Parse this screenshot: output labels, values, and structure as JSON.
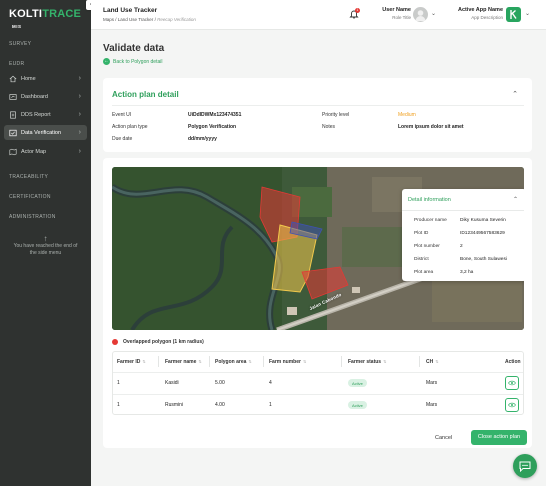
{
  "brand": {
    "logo_main": "KOLTI",
    "logo_accent": "TRACE",
    "logo_sub": "MIS"
  },
  "sidebar": {
    "sections": {
      "survey": "SURVEY",
      "eudr": "EUDR",
      "traceability": "TRACEABILITY",
      "certification": "CERTIFICATION",
      "administration": "ADMINISTRATION"
    },
    "items": [
      {
        "label": "Home",
        "icon": "home-icon",
        "active": false
      },
      {
        "label": "Dashboard",
        "icon": "dashboard-icon",
        "active": false
      },
      {
        "label": "DDS Report",
        "icon": "report-icon",
        "active": false
      },
      {
        "label": "Data Verification",
        "icon": "verification-icon",
        "active": true
      },
      {
        "label": "Actor Map",
        "icon": "map-icon",
        "active": false
      }
    ],
    "end_text_line1": "You have reached the end of",
    "end_text_line2": "the side menu"
  },
  "header": {
    "title": "Land Use Tracker",
    "breadcrumb": {
      "part1": "Maps",
      "part2": "Land Use Tracker",
      "current": "Reecap Verification"
    },
    "notification_count": "1",
    "user": {
      "name": "User Name",
      "role": "Role Title"
    },
    "app": {
      "name": "Active App Name",
      "description": "App Description"
    }
  },
  "page": {
    "title": "Validate data",
    "back_link": "Back to Polygon detail"
  },
  "action_plan": {
    "title": "Action plan detail",
    "fields": {
      "event_uid_label": "Event UI",
      "event_uid_value": "UiDdIDWMx123474351",
      "plan_type_label": "Action plan type",
      "plan_type_value": "Polygon Verification",
      "due_date_label": "Due date",
      "due_date_value": "dd/mm/yyyy",
      "priority_label": "Priority level",
      "priority_value": "Medium",
      "notes_label": "Notes",
      "notes_value": "Lorem ipsum dolor sit amet"
    }
  },
  "detail_info": {
    "title": "Detail information",
    "producer_label": "Producer name",
    "producer_value": "Diky Kusuma Severin",
    "plot_id_label": "Plot ID",
    "plot_id_value": "ID123449567583629",
    "plot_number_label": "Plot number",
    "plot_number_value": "2",
    "district_label": "District",
    "district_value": "Bone, South Sulawesi",
    "plot_area_label": "Plot area",
    "plot_area_value": "3,2 ha"
  },
  "map": {
    "road_label": "Jalan Cabondo"
  },
  "legend": {
    "overlap_label": "Overlapped polygon (1 km radius)",
    "overlap_color": "#e53935"
  },
  "table": {
    "headers": [
      "Farmer ID",
      "Farmer name",
      "Polygon area",
      "Farm number",
      "Farmer status",
      "CH",
      "Action"
    ],
    "rows": [
      {
        "farmer_id": "1",
        "farmer_name": "Kasidi",
        "polygon_area": "5.00",
        "farm_number": "4",
        "status": "Active",
        "ch": "Mars"
      },
      {
        "farmer_id": "1",
        "farmer_name": "Rusmini",
        "polygon_area": "4.00",
        "farm_number": "1",
        "status": "Active",
        "ch": "Mars"
      }
    ]
  },
  "actions": {
    "cancel": "Cancel",
    "close_plan": "Close action plan"
  },
  "colors": {
    "accent": "#34b36b",
    "sidebar_bg": "#2f3230",
    "priority_medium": "#f0a020"
  }
}
